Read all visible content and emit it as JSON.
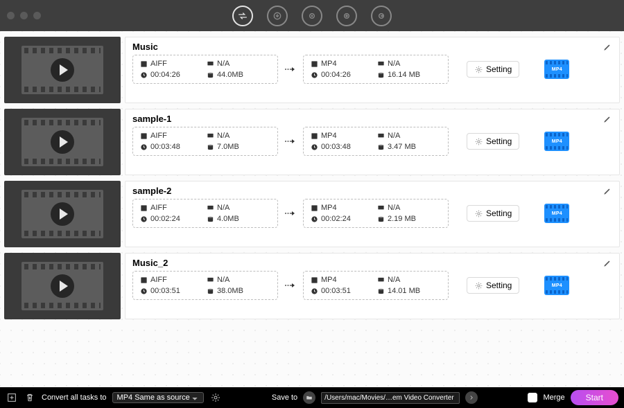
{
  "toolbar_icons": [
    "refresh",
    "target",
    "film-gear",
    "film-plus",
    "film-arrow"
  ],
  "items": [
    {
      "title": "Music",
      "src": {
        "format": "AIFF",
        "res": "N/A",
        "dur": "00:04:26",
        "size": "44.0MB"
      },
      "dst": {
        "format": "MP4",
        "res": "N/A",
        "dur": "00:04:26",
        "size": "16.14 MB"
      },
      "chip": "MP4"
    },
    {
      "title": "sample-1",
      "src": {
        "format": "AIFF",
        "res": "N/A",
        "dur": "00:03:48",
        "size": "7.0MB"
      },
      "dst": {
        "format": "MP4",
        "res": "N/A",
        "dur": "00:03:48",
        "size": "3.47 MB"
      },
      "chip": "MP4"
    },
    {
      "title": "sample-2",
      "src": {
        "format": "AIFF",
        "res": "N/A",
        "dur": "00:02:24",
        "size": "4.0MB"
      },
      "dst": {
        "format": "MP4",
        "res": "N/A",
        "dur": "00:02:24",
        "size": "2.19 MB"
      },
      "chip": "MP4"
    },
    {
      "title": "Music_2",
      "src": {
        "format": "AIFF",
        "res": "N/A",
        "dur": "00:03:51",
        "size": "38.0MB"
      },
      "dst": {
        "format": "MP4",
        "res": "N/A",
        "dur": "00:03:51",
        "size": "14.01 MB"
      },
      "chip": "MP4"
    }
  ],
  "setting_label": "Setting",
  "bottom": {
    "convert_label": "Convert all tasks to",
    "format_selected": "MP4 Same as source",
    "save_label": "Save to",
    "save_path": "/Users/mac/Movies/…em Video Converter",
    "merge_label": "Merge",
    "start_label": "Start"
  }
}
